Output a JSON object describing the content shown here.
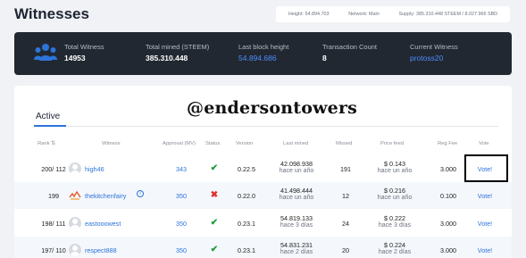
{
  "page": {
    "title": "Witnesses"
  },
  "network": {
    "height": "Height: 54.894.703",
    "network": "Network: Main",
    "supply": "Supply: 385.310.448 STEEM / 8.027.966 SBD"
  },
  "stats": [
    {
      "label": "Total Witness",
      "value": "14953"
    },
    {
      "label": "Total mined (STEEM)",
      "value": "385.310.448"
    },
    {
      "label": "Last block height",
      "value": "54.894.686"
    },
    {
      "label": "Transaction Count",
      "value": "8"
    },
    {
      "label": "Current Witness",
      "value": "protoss20"
    }
  ],
  "tabs": {
    "active": "Active"
  },
  "watermark": "@endersontowers",
  "table": {
    "headers": {
      "rank": "Rank",
      "witness": "Witness",
      "approval": "Approval (MV)",
      "status": "Status",
      "version": "Version",
      "last_mined": "Last mined",
      "missed": "Missed",
      "price_feed": "Price feed",
      "reg_fee": "Reg Fee",
      "vote": "Vote"
    },
    "rows": [
      {
        "rank": "200/ 112",
        "name": "high46",
        "approval": "343",
        "status": "✔",
        "version": "0.22.5",
        "lm_block": "42.098.938",
        "lm_ago": "hace un año",
        "missed": "191",
        "pf_price": "$ 0.143",
        "pf_ago": "hace un año",
        "reg_fee": "3.000",
        "vote": "Vote!"
      },
      {
        "rank": "199",
        "name": "thekitchenfairy",
        "approval": "350",
        "status": "✖",
        "version": "0.22.0",
        "lm_block": "41.498.444",
        "lm_ago": "hace un año",
        "missed": "12",
        "pf_price": "$ 0.216",
        "pf_ago": "hace un año",
        "reg_fee": "0.100",
        "vote": "Vote!"
      },
      {
        "rank": "198/ 111",
        "name": "eastooowest",
        "approval": "350",
        "status": "✔",
        "version": "0.23.1",
        "lm_block": "54.819.133",
        "lm_ago": "hace 3 días",
        "missed": "24",
        "pf_price": "$ 0.222",
        "pf_ago": "hace 3 días",
        "reg_fee": "3.000",
        "vote": "Vote!"
      },
      {
        "rank": "197/ 110",
        "name": "respect888",
        "approval": "350",
        "status": "✔",
        "version": "0.23.1",
        "lm_block": "54.831.231",
        "lm_ago": "hace 2 días",
        "missed": "20",
        "pf_price": "$ 0.224",
        "pf_ago": "hace 2 días",
        "reg_fee": "3.000",
        "vote": "Vote!"
      }
    ]
  }
}
